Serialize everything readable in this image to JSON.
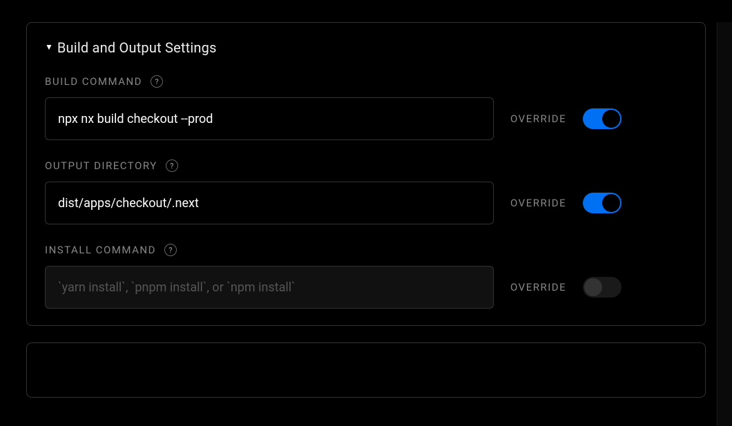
{
  "panel": {
    "title": "Build and Output Settings"
  },
  "settings": {
    "build_command": {
      "label": "BUILD COMMAND",
      "value": "npx nx build checkout --prod",
      "override_label": "OVERRIDE",
      "override_on": true
    },
    "output_directory": {
      "label": "OUTPUT DIRECTORY",
      "value": "dist/apps/checkout/.next",
      "override_label": "OVERRIDE",
      "override_on": true
    },
    "install_command": {
      "label": "INSTALL COMMAND",
      "placeholder": "`yarn install`, `pnpm install`, or `npm install`",
      "override_label": "OVERRIDE",
      "override_on": false
    }
  }
}
